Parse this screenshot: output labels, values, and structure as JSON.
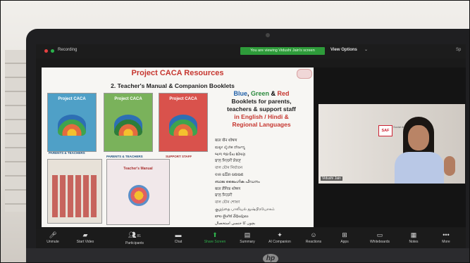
{
  "zoom": {
    "recording": "Recording",
    "viewing_banner": "You are viewing Vidushi Jain's screen",
    "view_options": "View Options",
    "caret": "⌄",
    "top_right": "Sp"
  },
  "slide": {
    "title": "Project CACA Resources",
    "subtitle": "2. Teacher's Manual & Companion Booklets",
    "book1_title": "Project CACA",
    "book2_title": "Project CACA",
    "book3_title": "Project CACA",
    "label_parents_teachers_1": "PARENTS & TEACHERS",
    "label_parents_teachers_2": "PARENTS & TEACHERS",
    "label_support_staff": "SUPPORT STAFF",
    "manual_title": "Teacher's Manual",
    "right_blue": "Blue",
    "right_comma": ", ",
    "right_green": "Green",
    "right_amp": " & ",
    "right_red": "Red",
    "right_line2": "Booklets for parents,",
    "right_line3": "teachers & support staff",
    "right_line4": "in English / Hindi &",
    "right_line5": "Regional Languages",
    "lang_lines": [
      "बाल यौन शोषण",
      "ಮಕ್ಕಳ ಲೈಂಗಿಕ ದೌರ್ಜನ್ಯ",
      "બાળ જાતીય શોષણ",
      "ਬਾਲ ਜਿਨਸੀ ਸ਼ੋਸ਼ਣ",
      "বাল যৌন নির্যাতন",
      "ବାଳ ଯୌନ ଶୋଷଣ",
      "ബാല ലൈംഗിക പീഡനം",
      "बाल लैंगिक शोषण",
      "ਬਾਲ ਜਿਨਸੀ",
      "বাল যৌন শোষণ",
      "குழந்தை பாலியல் துஷ்பிரயோகம்",
      "బాల లైంగిక వేధింపులు",
      "بچوں کا جنسی استحصال"
    ]
  },
  "video": {
    "saf_logo": "SAF",
    "saf_caption": "Social Awareness Foundation",
    "participant_name": "Vidushi Jain"
  },
  "toolbar": {
    "unmute": "Unmute",
    "start_video": "Start Video",
    "participants": "Participants",
    "participants_count": "81",
    "chat": "Chat",
    "share_screen": "Share Screen",
    "summary": "Summary",
    "ai_companion": "AI Companion",
    "reactions": "Reactions",
    "apps": "Apps",
    "whiteboards": "Whiteboards",
    "notes": "Notes",
    "more": "More"
  },
  "brand": {
    "laptop_logo": "hp"
  },
  "colors": {
    "accent_green": "#2e9b3a",
    "title_red": "#c6362f"
  }
}
